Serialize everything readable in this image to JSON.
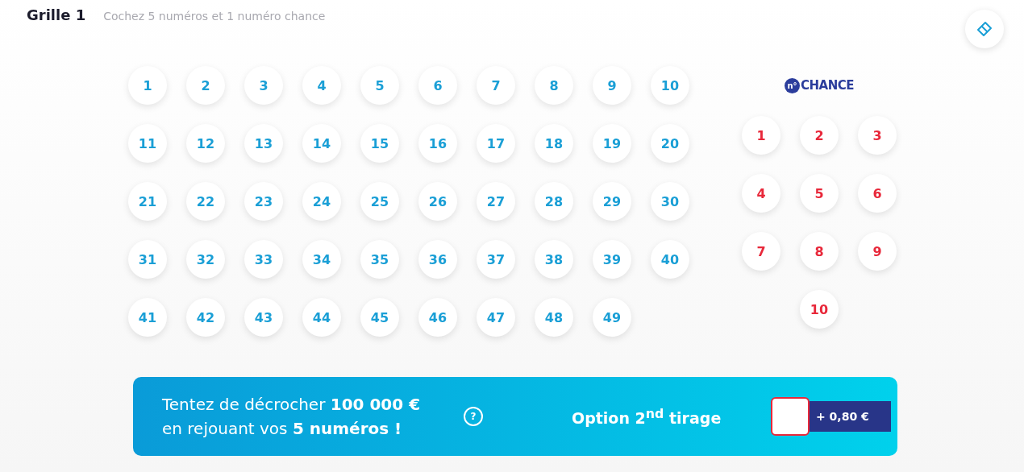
{
  "header": {
    "title": "Grille 1",
    "instruction": "Cochez 5 numéros et 1 numéro chance"
  },
  "numbers": [
    {
      "label": "1",
      "selected": false
    },
    {
      "label": "2",
      "selected": false
    },
    {
      "label": "3",
      "selected": false
    },
    {
      "label": "4",
      "selected": false
    },
    {
      "label": "5",
      "selected": false
    },
    {
      "label": "6",
      "selected": false
    },
    {
      "label": "7",
      "selected": false
    },
    {
      "label": "8",
      "selected": false
    },
    {
      "label": "9",
      "selected": false
    },
    {
      "label": "10",
      "selected": false
    },
    {
      "label": "11",
      "selected": false
    },
    {
      "label": "12",
      "selected": false
    },
    {
      "label": "13",
      "selected": false
    },
    {
      "label": "14",
      "selected": false
    },
    {
      "label": "15",
      "selected": false
    },
    {
      "label": "16",
      "selected": false
    },
    {
      "label": "17",
      "selected": false
    },
    {
      "label": "18",
      "selected": false
    },
    {
      "label": "19",
      "selected": false
    },
    {
      "label": "20",
      "selected": false
    },
    {
      "label": "21",
      "selected": false
    },
    {
      "label": "22",
      "selected": false
    },
    {
      "label": "23",
      "selected": false
    },
    {
      "label": "24",
      "selected": false
    },
    {
      "label": "25",
      "selected": false
    },
    {
      "label": "26",
      "selected": false
    },
    {
      "label": "27",
      "selected": false
    },
    {
      "label": "28",
      "selected": false
    },
    {
      "label": "29",
      "selected": false
    },
    {
      "label": "30",
      "selected": false
    },
    {
      "label": "31",
      "selected": false
    },
    {
      "label": "32",
      "selected": false
    },
    {
      "label": "33",
      "selected": false
    },
    {
      "label": "34",
      "selected": false
    },
    {
      "label": "35",
      "selected": false
    },
    {
      "label": "36",
      "selected": false
    },
    {
      "label": "37",
      "selected": false
    },
    {
      "label": "38",
      "selected": false
    },
    {
      "label": "39",
      "selected": false
    },
    {
      "label": "40",
      "selected": false
    },
    {
      "label": "41",
      "selected": false
    },
    {
      "label": "42",
      "selected": false
    },
    {
      "label": "43",
      "selected": false
    },
    {
      "label": "44",
      "selected": false
    },
    {
      "label": "45",
      "selected": false
    },
    {
      "label": "46",
      "selected": false
    },
    {
      "label": "47",
      "selected": false
    },
    {
      "label": "48",
      "selected": false
    },
    {
      "label": "49",
      "selected": false
    }
  ],
  "chance": {
    "logo_mark": "n°",
    "logo_text": "CHANCE",
    "numbers": [
      {
        "label": "1",
        "selected": false
      },
      {
        "label": "2",
        "selected": false
      },
      {
        "label": "3",
        "selected": false
      },
      {
        "label": "4",
        "selected": false
      },
      {
        "label": "5",
        "selected": false
      },
      {
        "label": "6",
        "selected": false
      },
      {
        "label": "7",
        "selected": false
      },
      {
        "label": "8",
        "selected": false
      },
      {
        "label": "9",
        "selected": false
      },
      {
        "label": "10",
        "selected": false
      }
    ]
  },
  "option": {
    "pitch_lines": [
      "Tentez de décrocher **100 000 €**",
      "en rejouant vos **5 numéros !**"
    ],
    "help": "?",
    "label": "Option 2$^{nd}$ tirage",
    "checked": false,
    "price": "+ 0,80 €"
  }
}
